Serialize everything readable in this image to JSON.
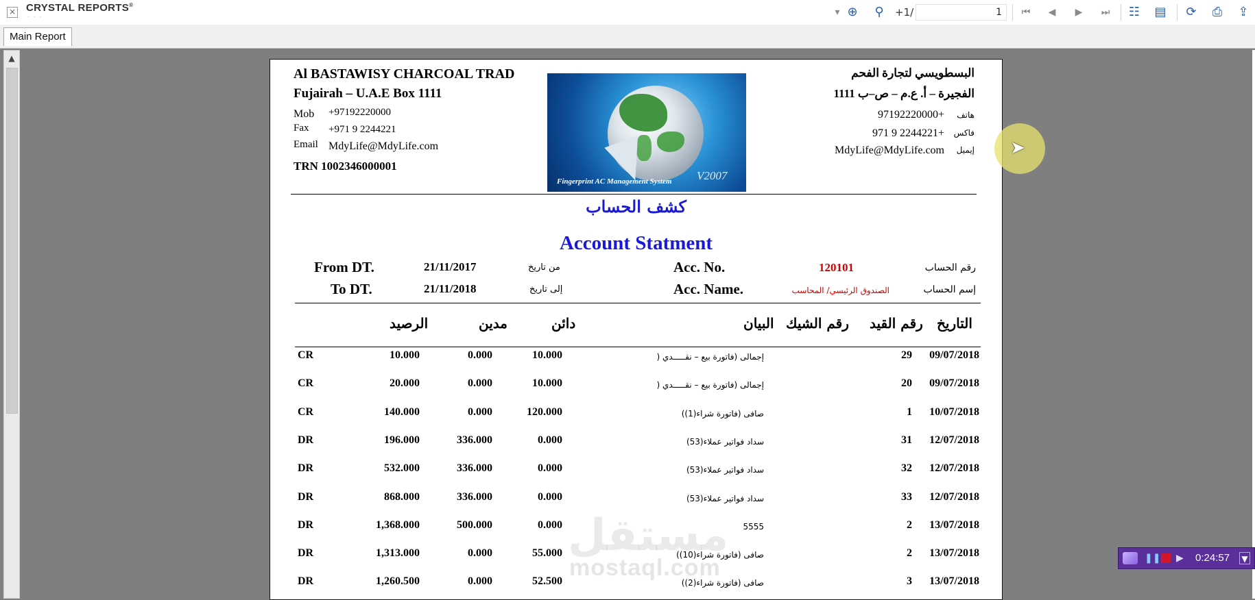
{
  "app": {
    "brand": "CRYSTAL REPORTS",
    "brand_mark": "®",
    "page_prefix": "+1/",
    "page_value": "1",
    "tab_main": "Main Report"
  },
  "toolbar_icons": [
    "dropdown-arrow-icon",
    "find-zoom-icon",
    "binoculars-icon",
    "first-page-icon",
    "previous-page-icon",
    "next-page-icon",
    "last-page-icon",
    "group-tree-icon",
    "parameters-icon",
    "refresh-icon",
    "print-icon",
    "export-icon"
  ],
  "report": {
    "company_en": "Al BASTAWISY CHARCOAL TRAD",
    "address_en": "Fujairah – U.A.E Box 1111",
    "mob_label": "Mob",
    "mob_value": "+97192220000",
    "fax_label": "Fax",
    "fax_value": "+971 9 2244221",
    "email_label": "Email",
    "email_value": "MdyLife@MdyLife.com",
    "trn": "TRN 1002346000001",
    "company_ar": "البسطويسي لتجارة الفحم",
    "address_ar": "الفجيرة – أ. ع.م – ص–ب 1111",
    "phone_ar_label": "هاتف",
    "phone_ar_value": "97192220000+",
    "fax_ar_label": "فاكس",
    "fax_ar_value": "971 9 2244221+",
    "email_ar_label": "إيميل",
    "email_ar_value": "MdyLife@MdyLife.com",
    "logo_caption": "Fingerprint AC Management System",
    "logo_year": "V2007",
    "title_ar": "كشف الحساب",
    "title_en": "Account Statment",
    "from_label": "From DT.",
    "from_value": "21/11/2017",
    "from_label_ar": "من تاريخ",
    "to_label": "To DT.",
    "to_value": "21/11/2018",
    "to_label_ar": "إلى تاريخ",
    "acc_no_label": "Acc. No.",
    "acc_no_value": "120101",
    "acc_no_label_ar": "رقم الحساب",
    "acc_name_label": "Acc. Name.",
    "acc_name_value": "الصندوق الرئيسي/ المحاسب",
    "acc_name_label_ar": "إسم الحساب",
    "columns": {
      "balance": "الرصيد",
      "debit": "مدين",
      "credit": "دائن",
      "description": "البيان",
      "cheque_no": "رقم الشيك",
      "entry_no": "رقم القيد",
      "date": "التاريخ"
    },
    "rows": [
      {
        "type": "CR",
        "balance": "10.000",
        "debit": "0.000",
        "credit": "10.000",
        "description": "إجمالى (فاتورة بيع – نقـــــدي (",
        "entry": "29",
        "date": "09/07/2018"
      },
      {
        "type": "CR",
        "balance": "20.000",
        "debit": "0.000",
        "credit": "10.000",
        "description": "إجمالى (فاتورة بيع – نقـــــدي (",
        "entry": "20",
        "date": "09/07/2018"
      },
      {
        "type": "CR",
        "balance": "140.000",
        "debit": "0.000",
        "credit": "120.000",
        "description": "صافى (فاتورة شراء(1))",
        "entry": "1",
        "date": "10/07/2018"
      },
      {
        "type": "DR",
        "balance": "196.000",
        "debit": "336.000",
        "credit": "0.000",
        "description": "سداد فواتير عملاء(53)",
        "entry": "31",
        "date": "12/07/2018"
      },
      {
        "type": "DR",
        "balance": "532.000",
        "debit": "336.000",
        "credit": "0.000",
        "description": "سداد فواتير عملاء(53)",
        "entry": "32",
        "date": "12/07/2018"
      },
      {
        "type": "DR",
        "balance": "868.000",
        "debit": "336.000",
        "credit": "0.000",
        "description": "سداد فواتير عملاء(53)",
        "entry": "33",
        "date": "12/07/2018"
      },
      {
        "type": "DR",
        "balance": "1,368.000",
        "debit": "500.000",
        "credit": "0.000",
        "description": "5555",
        "entry": "2",
        "date": "13/07/2018"
      },
      {
        "type": "DR",
        "balance": "1,313.000",
        "debit": "0.000",
        "credit": "55.000",
        "description": "صافى (فاتورة شراء(10))",
        "entry": "2",
        "date": "13/07/2018"
      },
      {
        "type": "DR",
        "balance": "1,260.500",
        "debit": "0.000",
        "credit": "52.500",
        "description": "صافى (فاتورة شراء(2))",
        "entry": "3",
        "date": "13/07/2018"
      }
    ]
  },
  "recorder": {
    "time": "0:24:57"
  },
  "watermark": {
    "ar": "مستقل",
    "en": "mostaql.com"
  },
  "colors": {
    "accent_blue": "#1a1ad6",
    "accent_red": "#d40000",
    "recorder": "#5b2f9a",
    "cursor_halo": "#e6e16e"
  }
}
